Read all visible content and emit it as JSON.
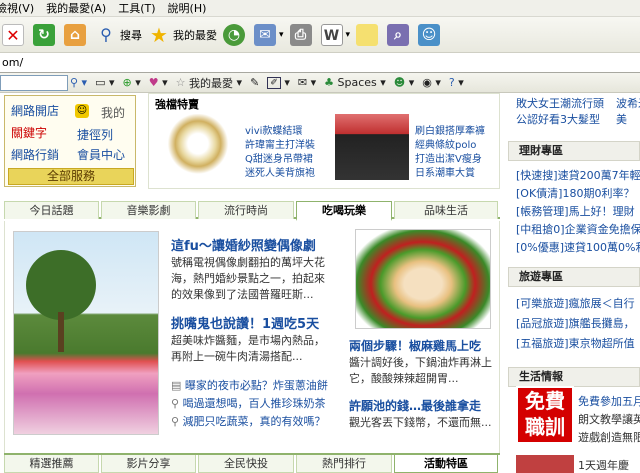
{
  "menubar": {
    "items": [
      "檢視(V)",
      "我的最愛(A)",
      "工具(T)",
      "說明(H)"
    ]
  },
  "toolbar": {
    "search": "搜尋",
    "favorites": "我的最愛"
  },
  "address": {
    "text": "om/"
  },
  "gbar": {
    "favorites": "我的最愛",
    "spaces": "Spaces"
  },
  "nav": {
    "items": [
      "網路開店",
      "關鍵字",
      "網路行銷",
      "我的",
      "捷徑列",
      "會員中心"
    ],
    "all": "全部服務"
  },
  "featured": {
    "title": "強檔特賣",
    "links": [
      "vivi款蝶結環",
      "許瑋甯主打洋裝",
      "Q甜迷身吊帶裙",
      "迷死人美背旗袍",
      "刷白銀搭厚牽褲",
      "經典條紋polo",
      "打造出潔V瘦身",
      "日系潮車大賞"
    ]
  },
  "tabs1": [
    "今日話題",
    "音樂影劇",
    "流行時尚",
    "吃喝玩樂",
    "品味生活"
  ],
  "main": {
    "h1": "這fu～讓婚紗照變偶像劇",
    "p1": [
      "號稱電視偶像劇翻拍的萬坪大花",
      "海，熱門婚紗景點之一，拍起來",
      "的效果像到了法國普羅旺斯..."
    ],
    "h2": "挑嘴鬼也說讚！1週吃5天",
    "p2": [
      "超美味炸醬麵，是市場內熱品，",
      "再附上一碗牛肉清湯搭配..."
    ],
    "bullets": [
      "曝家的夜市必點？炸蛋蔥油餅",
      "喝過還想喝，百人推珍珠奶茶",
      "減肥只吃蔬菜，真的有效嗎？"
    ],
    "h3": "兩個步驟！椒麻雞馬上吃",
    "p3": [
      "醬汁調好後，下鍋油炸再淋上",
      "它，酸酸辣辣超開胃..."
    ],
    "h4": "許願池的錢…最後誰拿走",
    "p4": [
      "觀光客丟下錢幣，不還而無..."
    ]
  },
  "tabs2": [
    "精選推薦",
    "影片分享",
    "全民快投",
    "熱門排行",
    "活動特區"
  ],
  "right": {
    "top": [
      "敗犬女王潮流行頭",
      "波希米",
      "公認好看3大髮型",
      "美"
    ],
    "finance_head": "理財專區",
    "finance": [
      "[快速搜]速貸200萬7年輕",
      "[OK債清]180期0利率？",
      "[帳務管理]馬上好！理財",
      "[中租搶0]企業資金免擔保",
      "[0%優惠]速貸100萬0%利"
    ],
    "travel_head": "旅遊專區",
    "travel": [
      "[可樂旅遊]瘋旅展＜自行",
      "[品冠旅遊]旗艦長攤島，",
      "[五福旅遊]東京物超所值"
    ],
    "life_head": "生活情報",
    "free": "免費職訓",
    "life": [
      "免費參加五月",
      "朗文教學讓英",
      "遊戲創造無限"
    ],
    "bottom": "1天週年慶"
  },
  "colors": {
    "accent": "#1a4fa0",
    "green": "#8fb36c",
    "red": "#d40000"
  }
}
